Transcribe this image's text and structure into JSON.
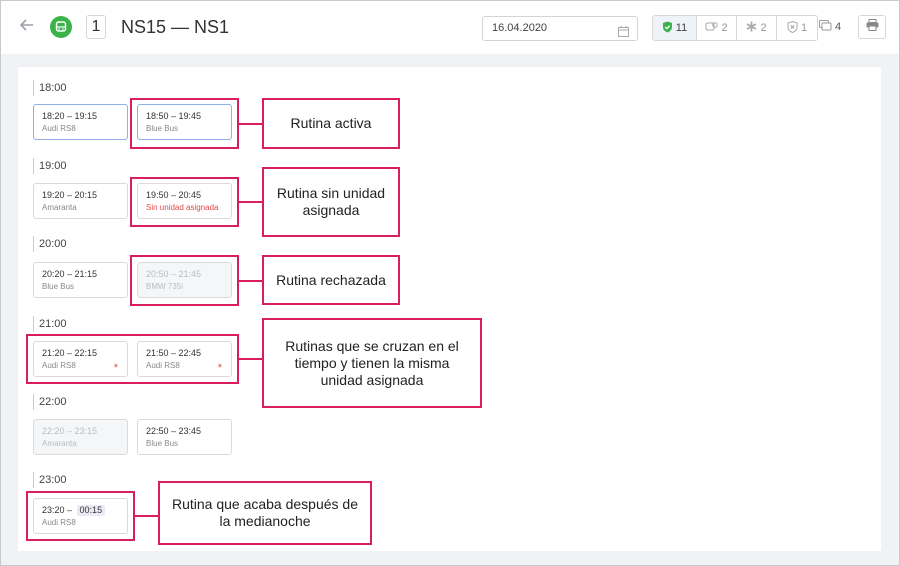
{
  "header": {
    "route_number": "1",
    "route_title": "NS15 — NS1",
    "date_value": "16.04.2020",
    "stats": [
      {
        "icon": "shield-check-icon",
        "value": "11"
      },
      {
        "icon": "bus-pin-icon",
        "value": "2"
      },
      {
        "icon": "asterisk-icon",
        "value": "2"
      },
      {
        "icon": "shield-x-icon",
        "value": "1"
      }
    ],
    "extra_stat": {
      "icon": "copy-route-icon",
      "value": "4"
    }
  },
  "hours": [
    "18:00",
    "19:00",
    "20:00",
    "21:00",
    "22:00",
    "23:00"
  ],
  "routines": [
    {
      "time": "18:20 – 19:15",
      "unit": "Audi RS8"
    },
    {
      "time": "18:50 – 19:45",
      "unit": "Blue Bus"
    },
    {
      "time": "19:20 – 20:15",
      "unit": "Amaranta"
    },
    {
      "time": "19:50 – 20:45",
      "unit": "Sin unidad asignada"
    },
    {
      "time": "20:20 – 21:15",
      "unit": "Blue Bus"
    },
    {
      "time": "20:50 – 21:45",
      "unit": "BMW 735i"
    },
    {
      "time": "21:20 – 22:15",
      "unit": "Audi RS8"
    },
    {
      "time": "21:50 – 22:45",
      "unit": "Audi RS8"
    },
    {
      "time": "22:20 – 23:15",
      "unit": "Amaranta"
    },
    {
      "time": "22:50 – 23:45",
      "unit": "Blue Bus"
    },
    {
      "time_start": "23:20 –",
      "time_end": "00:15",
      "unit": "Audi RS8"
    }
  ],
  "callouts": {
    "active": "Rutina activa",
    "no_unit": "Rutina sin unidad asignada",
    "rejected": "Rutina rechazada",
    "overlap": "Rutinas que se cruzan en el tiempo y tienen la misma unidad asignada",
    "midnight": "Rutina que acaba después de la medianoche"
  },
  "colors": {
    "accent": "#d81e5b",
    "route_icon": "#3bb34a",
    "warning": "#e04b4b",
    "active_border": "#8fb0e8"
  }
}
